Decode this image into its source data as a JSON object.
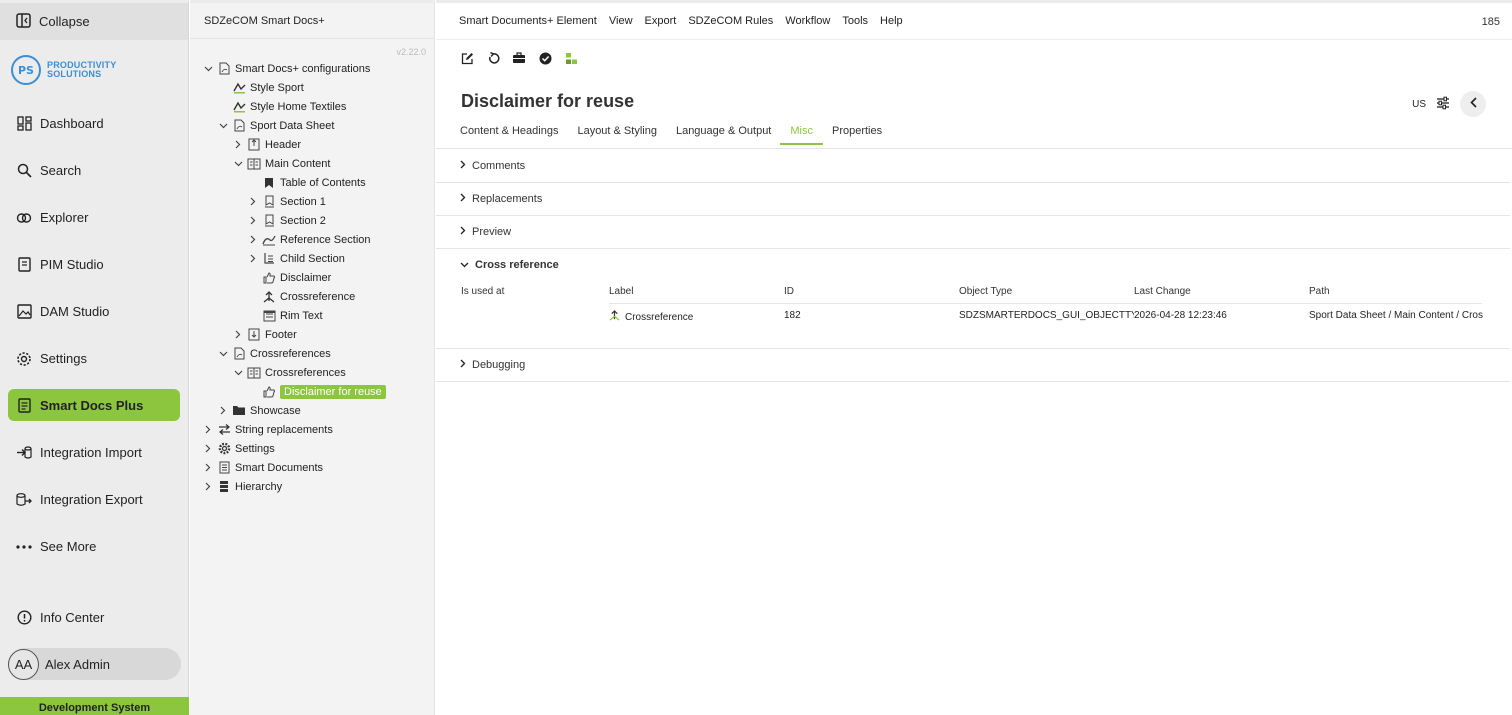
{
  "nav": {
    "collapse_label": "Collapse",
    "logo_initials": "PS",
    "logo_line1": "PRODUCTIVITY",
    "logo_line2": "SOLUTIONS",
    "items": [
      {
        "label": "Dashboard",
        "icon": "dashboard-icon"
      },
      {
        "label": "Search",
        "icon": "search-icon"
      },
      {
        "label": "Explorer",
        "icon": "explorer-icon"
      },
      {
        "label": "PIM Studio",
        "icon": "pim-studio-icon"
      },
      {
        "label": "DAM Studio",
        "icon": "dam-studio-icon"
      },
      {
        "label": "Settings",
        "icon": "gear-icon"
      },
      {
        "label": "Smart Docs Plus",
        "icon": "document-icon"
      },
      {
        "label": "Integration Import",
        "icon": "import-icon"
      },
      {
        "label": "Integration Export",
        "icon": "export-icon"
      },
      {
        "label": "See More",
        "icon": "more-icon"
      }
    ],
    "info_center": "Info Center",
    "user_initials": "AA",
    "user_name": "Alex Admin",
    "environment": "Development System"
  },
  "tree": {
    "title": "SDZeCOM Smart Docs+",
    "version": "v2.22.0",
    "nodes": [
      {
        "label": "Smart Docs+ configurations"
      },
      {
        "label": "Style Sport"
      },
      {
        "label": "Style Home Textiles"
      },
      {
        "label": "Sport Data Sheet"
      },
      {
        "label": "Header"
      },
      {
        "label": "Main Content"
      },
      {
        "label": "Table of Contents"
      },
      {
        "label": "Section 1"
      },
      {
        "label": "Section 2"
      },
      {
        "label": "Reference Section"
      },
      {
        "label": "Child Section"
      },
      {
        "label": "Disclaimer"
      },
      {
        "label": "Crossreference"
      },
      {
        "label": "Rim Text"
      },
      {
        "label": "Footer"
      },
      {
        "label": "Crossreferences"
      },
      {
        "label": "Crossreferences"
      },
      {
        "label": "Disclaimer for reuse"
      },
      {
        "label": "Showcase"
      },
      {
        "label": "String replacements"
      },
      {
        "label": "Settings"
      },
      {
        "label": "Smart Documents"
      },
      {
        "label": "Hierarchy"
      }
    ]
  },
  "menubar": {
    "items": [
      "Smart Documents+ Element",
      "View",
      "Export",
      "SDZeCOM Rules",
      "Workflow",
      "Tools",
      "Help"
    ],
    "count": "185"
  },
  "page": {
    "title": "Disclaimer for reuse",
    "locale": "US"
  },
  "tabs": [
    "Content & Headings",
    "Layout & Styling",
    "Language & Output",
    "Misc",
    "Properties"
  ],
  "sections": {
    "comments": "Comments",
    "replacements": "Replacements",
    "preview": "Preview",
    "crossref": "Cross reference",
    "debugging": "Debugging"
  },
  "crossref": {
    "used_at_label": "Is used at",
    "columns": [
      "Label",
      "ID",
      "Object Type",
      "Last Change",
      "Path"
    ],
    "row": {
      "label": "Crossreference",
      "id": "182",
      "object_type": "SDZSMARTERDOCS_GUI_OBJECTTYPE_C",
      "last_change": "2026-04-28 12:23:46",
      "path": "Sport Data Sheet / Main Content / Cros"
    }
  },
  "colors": {
    "accent": "#8cc63f",
    "logo": "#3a8fd6"
  }
}
